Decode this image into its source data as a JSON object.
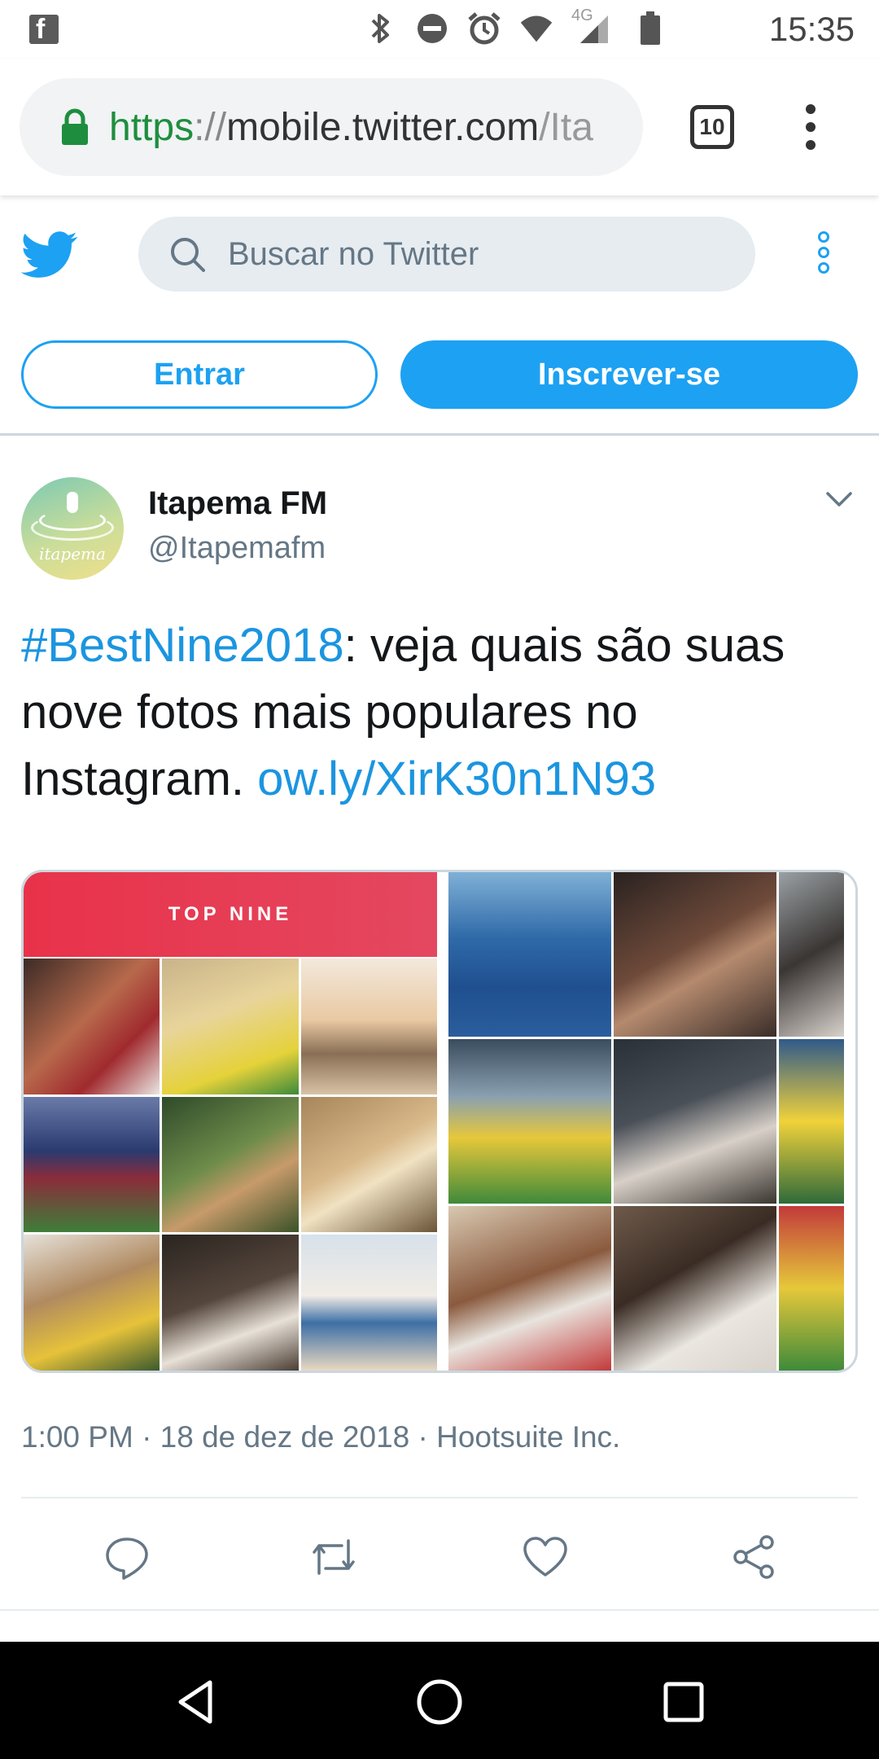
{
  "status_bar": {
    "time": "15:35",
    "network": "4G",
    "notification_icon": "facebook-icon"
  },
  "browser": {
    "url_scheme": "https",
    "url_separator": "://",
    "url_host": "mobile.twitter.com",
    "url_path": "/Ita",
    "tab_count": "10"
  },
  "twitter_header": {
    "search_placeholder": "Buscar no Twitter",
    "login_label": "Entrar",
    "signup_label": "Inscrever-se",
    "brand_color": "#1da1f2"
  },
  "tweet": {
    "author_name": "Itapema FM",
    "author_handle": "@Itapemafm",
    "avatar_label": "itapema",
    "hashtag": "#BestNine2018",
    "text_main": ": veja quais são suas nove fotos mais populares no Instagram.",
    "link": "ow.ly/XirK30n1N93",
    "media_banner": "TOP NINE",
    "meta": "1:00 PM · 18 de dez de 2018 · Hootsuite Inc."
  },
  "actions": [
    "reply-icon",
    "retweet-icon",
    "like-icon",
    "share-icon"
  ],
  "nav": [
    "back-icon",
    "home-icon",
    "recents-icon"
  ]
}
